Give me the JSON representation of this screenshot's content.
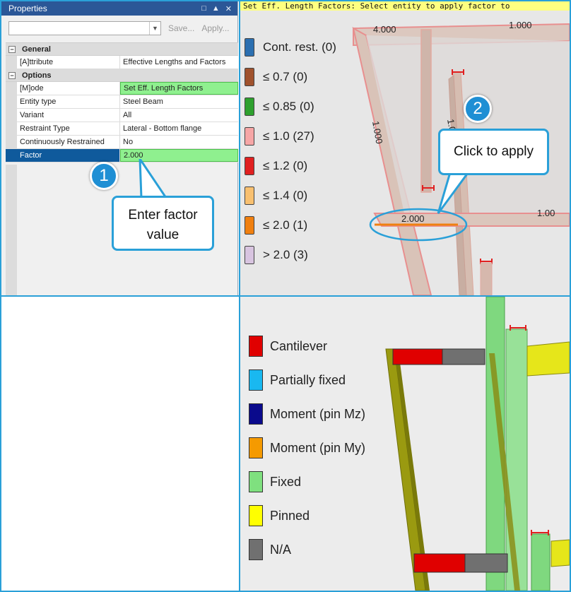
{
  "properties": {
    "title": "Properties",
    "toolbar": {
      "save": "Save...",
      "apply": "Apply..."
    },
    "categories": {
      "general": "General",
      "options": "Options"
    },
    "rows": [
      {
        "name": "[A]ttribute",
        "value": "Effective Lengths and Factors"
      },
      {
        "name": "[M]ode",
        "value": "Set Eff. Length Factors"
      },
      {
        "name": "Entity type",
        "value": "Steel Beam"
      },
      {
        "name": "Variant",
        "value": "All"
      },
      {
        "name": "Restraint Type",
        "value": "Lateral - Bottom flange"
      },
      {
        "name": "Continuously Restrained",
        "value": "No"
      },
      {
        "name": "Factor",
        "value": "2.000"
      }
    ]
  },
  "callouts": {
    "one": {
      "number": "1",
      "line1": "Enter factor",
      "line2": "value"
    },
    "two": {
      "number": "2",
      "text": "Click to apply"
    }
  },
  "viewport_top": {
    "status": "Set Eff. Length Factors: Select entity to apply factor to",
    "legend": [
      {
        "label": "Cont. rest. (0)",
        "color": "#2b6fb0"
      },
      {
        "label": "≤ 0.7 (0)",
        "color": "#a0522d"
      },
      {
        "label": "≤ 0.85 (0)",
        "color": "#2ea02e"
      },
      {
        "label": "≤ 1.0 (27)",
        "color": "#f6a6a6"
      },
      {
        "label": "≤ 1.2 (0)",
        "color": "#e02020"
      },
      {
        "label": "≤ 1.4 (0)",
        "color": "#f8c070"
      },
      {
        "label": "≤ 2.0 (1)",
        "color": "#f08010"
      },
      {
        "label": "> 2.0 (3)",
        "color": "#d8c4e0"
      }
    ],
    "dims": {
      "d1": "4.000",
      "d2": "1.000",
      "d3": "1.000",
      "d4": "1.0",
      "d5": "2.000",
      "d6": "1.00"
    }
  },
  "viewport_bottom": {
    "legend": [
      {
        "label": "Cantilever",
        "color": "#e00000"
      },
      {
        "label": "Partially fixed",
        "color": "#19b8f0"
      },
      {
        "label": "Moment (pin Mz)",
        "color": "#0a0a8c"
      },
      {
        "label": "Moment (pin My)",
        "color": "#f59a00"
      },
      {
        "label": "Fixed",
        "color": "#7fe07f"
      },
      {
        "label": "Pinned",
        "color": "#ffff00"
      },
      {
        "label": "N/A",
        "color": "#707070"
      }
    ]
  }
}
